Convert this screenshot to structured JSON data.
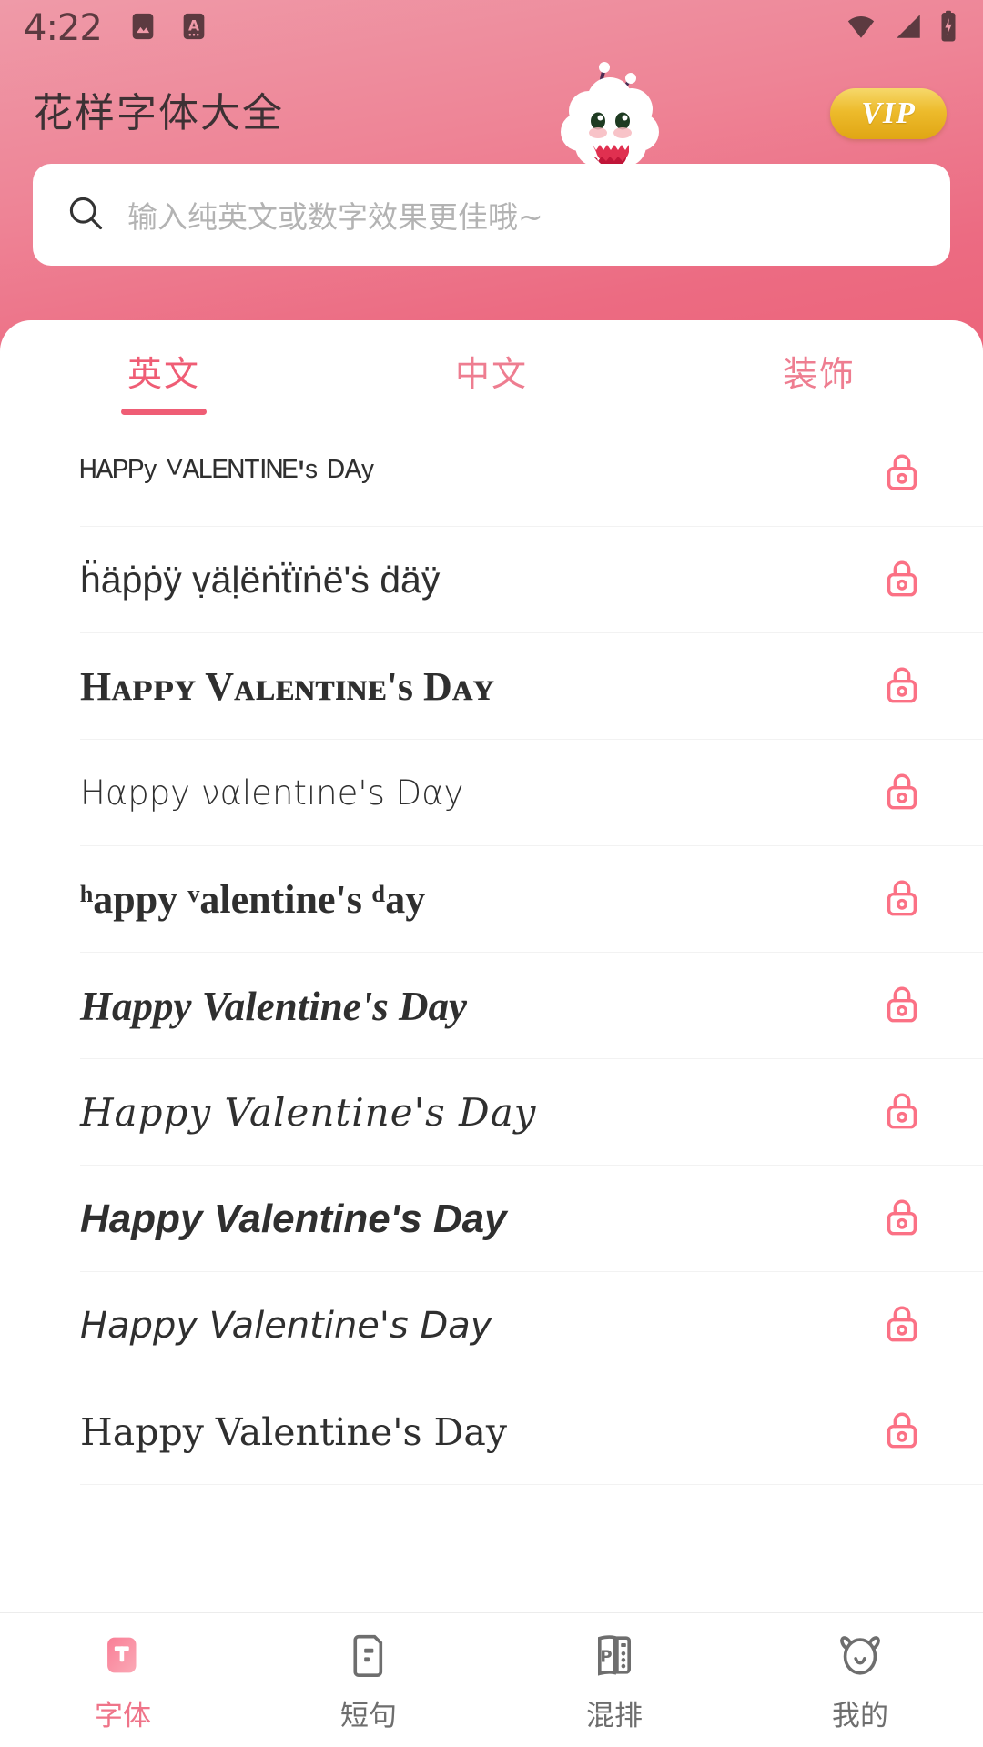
{
  "status_bar": {
    "time": "4:22",
    "left_icons": [
      "image-icon",
      "screenshot-app-icon"
    ],
    "right_icons": [
      "wifi-icon",
      "signal-icon",
      "battery-charging-icon"
    ]
  },
  "header": {
    "app_title": "花样字体大全",
    "vip_label": "VIP",
    "mascot": "cloud-mascot-icon",
    "background_color": "#ec6b82"
  },
  "search": {
    "icon": "search-icon",
    "value": "",
    "placeholder": "输入纯英文或数字效果更佳哦~"
  },
  "tabs": {
    "active_index": 0,
    "items": [
      {
        "label": "英文"
      },
      {
        "label": "中文"
      },
      {
        "label": "装饰"
      }
    ]
  },
  "font_list": {
    "lock_icon": "lock-icon",
    "rows": [
      {
        "text": "ᴴᴬᴾᴾʸ ⱽᴬᴸᴱᴺᵀᴵᴺᴱ'ˢ ᴰᴬʸ",
        "plain": "Happy Valentine's Day",
        "locked": true
      },
      {
        "text": "ḧäṗṗÿ ṿäḷëṅẗïṅë'ṡ ḋäÿ",
        "plain": "Happy Valentine's Day",
        "locked": true
      },
      {
        "text": "Hᴀᴘᴘʏ Vᴀʟᴇɴᴛɪɴᴇ's Dᴀʏ",
        "plain": "Happy Valentine's Day",
        "locked": true
      },
      {
        "text": "Hαppy ναlentıne's Dαy",
        "plain": "Happy Valentine's Day",
        "locked": true
      },
      {
        "text": "ʰappy ᵛalentine's ᵈay",
        "plain": "Happy Valentine's Day",
        "locked": true
      },
      {
        "text": "Happy Valentine's Day",
        "plain": "Happy Valentine's Day",
        "locked": true
      },
      {
        "text": "Happy Valentine's Day",
        "plain": "Happy Valentine's Day",
        "locked": true
      },
      {
        "text": "Happy Valentine's Day",
        "plain": "Happy Valentine's Day",
        "locked": true
      },
      {
        "text": "Happy Valentine's Day",
        "plain": "Happy Valentine's Day",
        "locked": true
      },
      {
        "text": "Happy Valentine's Day",
        "plain": "Happy Valentine's Day",
        "locked": true
      }
    ]
  },
  "bottom_nav": {
    "active_index": 0,
    "items": [
      {
        "label": "字体",
        "icon": "font-t-icon"
      },
      {
        "label": "短句",
        "icon": "phrase-card-icon"
      },
      {
        "label": "混排",
        "icon": "mixed-layout-icon"
      },
      {
        "label": "我的",
        "icon": "bear-profile-icon"
      }
    ]
  },
  "colors": {
    "accent": "#ef5d75",
    "header_top": "#ef9aa8",
    "header_bottom": "#ec6278",
    "vip_gold": "#edbb2c"
  }
}
